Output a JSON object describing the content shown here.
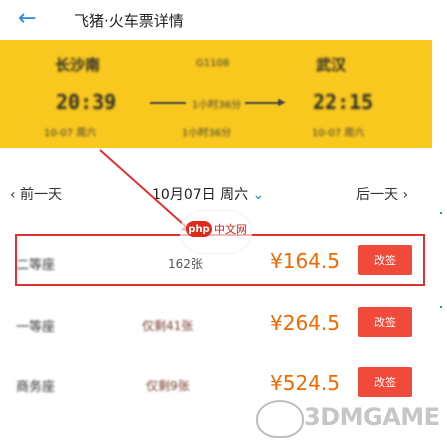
{
  "header": {
    "back_icon": "arrow-left-icon",
    "title": "飞猪·火车票详情"
  },
  "banner": {
    "from_station": "长沙南",
    "train_no": "G1108",
    "to_station": "武汉",
    "depart_time": "20:39",
    "duration": "1小时36分",
    "arrive_time": "22:15",
    "depart_note": "10-07 周六",
    "arrive_note": "10-07 周六",
    "duration_note": "1小时36分"
  },
  "datebar": {
    "prev": "‹ 前一天",
    "date": "10月07日 周六",
    "chevron": "chevron-down-icon",
    "next": "后一天 ›"
  },
  "tickets": [
    {
      "seat": "二等座",
      "left": "162张",
      "price": "¥164.5",
      "action": "改签"
    },
    {
      "seat": "一等座",
      "left": "仅剩41张",
      "price": "¥264.5",
      "action": "改签"
    },
    {
      "seat": "商务座",
      "left": "仅剩9张",
      "price": "¥524.5",
      "action": "改签"
    }
  ],
  "overlay_logo": {
    "brand": "php",
    "text": "中文网"
  },
  "watermark": {
    "text": "3DMGAME"
  },
  "colors": {
    "banner": "#f9c81e",
    "price": "#ef6a00",
    "button": "#ef4a3a",
    "highlight": "#e03131",
    "accent": "#2b86e0"
  }
}
